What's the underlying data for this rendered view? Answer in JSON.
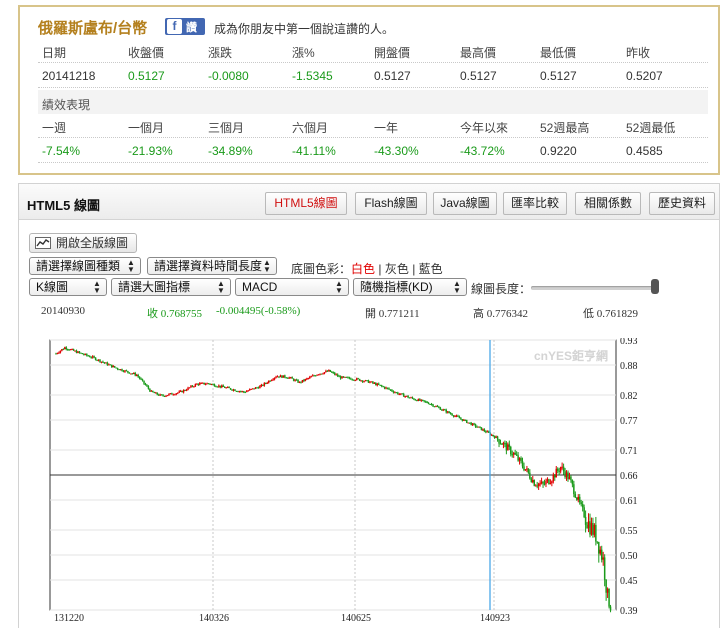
{
  "quote": {
    "title": "俄羅斯盧布/台幣",
    "fb_label": "讚",
    "like_text": "成為你朋友中第一個說這讚的人。",
    "headers": [
      "日期",
      "收盤價",
      "漲跌",
      "漲%",
      "開盤價",
      "最高價",
      "最低價",
      "昨收"
    ],
    "values": [
      "20141218",
      "0.5127",
      "-0.0080",
      "-1.5345",
      "0.5127",
      "0.5127",
      "0.5127",
      "0.5207"
    ],
    "perf_title": "績效表現",
    "perf_headers": [
      "一週",
      "一個月",
      "三個月",
      "六個月",
      "一年",
      "今年以來",
      "52週最高",
      "52週最低"
    ],
    "perf_values": [
      "-7.54%",
      "-21.93%",
      "-34.89%",
      "-41.11%",
      "-43.30%",
      "-43.72%",
      "0.9220",
      "0.4585"
    ]
  },
  "panel": {
    "title": "HTML5 線圖",
    "tabs": [
      "HTML5線圖",
      "Flash線圖",
      "Java線圖",
      "匯率比較",
      "相關係數",
      "歷史資料"
    ],
    "active_tab": 0
  },
  "controls": {
    "full_button": "開啟全版線圖",
    "select_chart_type": "請選擇線圖種類",
    "select_period": "請選擇資料時間長度",
    "bg_label": "底圖色彩：",
    "bg_white": "白色",
    "bg_gray": "灰色",
    "bg_blue": "藍色",
    "bg_sep": "|",
    "select_k": "K線圖",
    "select_main_indicator": "請選大圖指標",
    "select_macd": "MACD",
    "select_kd": "隨機指標(KD)",
    "length_label": "線圖長度："
  },
  "info": {
    "date": "20140930",
    "close": "收 0.768755",
    "change": "-0.004495(-0.58%)",
    "open": "開 0.771211",
    "high": "高 0.776342",
    "low": "低 0.761829"
  },
  "colors": {
    "up": "#e00000",
    "down": "#1a9a1a",
    "cursor": "#4aa8e8",
    "border_gold": "#d8c48a"
  },
  "chart_data": {
    "type": "candlestick",
    "watermark": "cnYES鉅亨網",
    "yticks": [
      "0.93",
      "0.88",
      "0.82",
      "0.77",
      "0.71",
      "0.66",
      "0.61",
      "0.55",
      "0.50",
      "0.45",
      "0.39"
    ],
    "ylim": [
      0.39,
      0.93
    ],
    "xticks": [
      "131220",
      "140326",
      "140625",
      "140923"
    ],
    "reference_line": 0.66,
    "cursor_date": "20140930",
    "keypoints": [
      [
        0,
        0.903
      ],
      [
        6,
        0.915
      ],
      [
        15,
        0.905
      ],
      [
        25,
        0.895
      ],
      [
        40,
        0.875
      ],
      [
        55,
        0.86
      ],
      [
        65,
        0.826
      ],
      [
        72,
        0.818
      ],
      [
        85,
        0.826
      ],
      [
        96,
        0.842
      ],
      [
        104,
        0.843
      ],
      [
        115,
        0.835
      ],
      [
        128,
        0.826
      ],
      [
        140,
        0.838
      ],
      [
        150,
        0.858
      ],
      [
        158,
        0.856
      ],
      [
        166,
        0.845
      ],
      [
        178,
        0.862
      ],
      [
        186,
        0.868
      ],
      [
        194,
        0.855
      ],
      [
        204,
        0.852
      ],
      [
        214,
        0.846
      ],
      [
        224,
        0.835
      ],
      [
        234,
        0.822
      ],
      [
        244,
        0.812
      ],
      [
        254,
        0.804
      ],
      [
        264,
        0.79
      ],
      [
        276,
        0.772
      ],
      [
        288,
        0.755
      ],
      [
        300,
        0.735
      ],
      [
        312,
        0.702
      ],
      [
        320,
        0.672
      ],
      [
        326,
        0.645
      ],
      [
        332,
        0.64
      ],
      [
        338,
        0.654
      ],
      [
        344,
        0.676
      ],
      [
        350,
        0.652
      ],
      [
        356,
        0.608
      ],
      [
        362,
        0.568
      ],
      [
        368,
        0.54
      ],
      [
        373,
        0.49
      ],
      [
        376,
        0.415
      ],
      [
        378,
        0.402
      ]
    ]
  }
}
